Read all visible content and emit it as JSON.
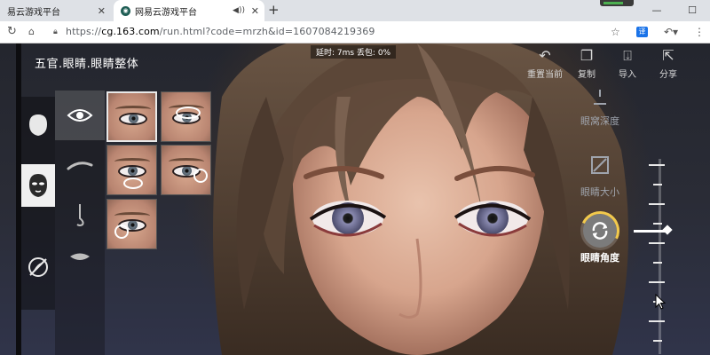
{
  "browser": {
    "tabs": [
      {
        "title": "易云游戏平台",
        "active": false
      },
      {
        "title": "网易云游戏平台",
        "active": true
      }
    ],
    "new_tab": "+",
    "window_controls": {
      "minimize": "—",
      "maximize": "☐",
      "close": "✕"
    },
    "url": {
      "scheme": "https://",
      "host": "cg.163.com",
      "path": "/run.html?code=mrzh&id=1607084219369"
    },
    "ext_badge": "译"
  },
  "game": {
    "latency_text": "延时: 7ms   丢包: 0%",
    "breadcrumb": "五官.眼睛.眼睛整体",
    "top_actions": [
      {
        "label": "重置当前",
        "icon": "reset-icon"
      },
      {
        "label": "复制",
        "icon": "copy-icon"
      },
      {
        "label": "导入",
        "icon": "import-icon"
      },
      {
        "label": "分享",
        "icon": "share-icon"
      }
    ],
    "params": [
      {
        "label": "眼窝深度",
        "icon": "eye-socket-icon",
        "active": false
      },
      {
        "label": "眼睛大小",
        "icon": "resize-icon",
        "active": false
      },
      {
        "label": "眼睛角度",
        "icon": "rotate-icon",
        "active": true
      }
    ],
    "categories": [
      {
        "icon": "head-shape-icon",
        "active": false
      },
      {
        "icon": "face-features-icon",
        "active": true
      },
      {
        "icon": "makeup-icon",
        "active": false
      }
    ],
    "sub_categories": [
      {
        "icon": "eye-icon",
        "active": true
      },
      {
        "icon": "eyebrow-icon",
        "active": false
      },
      {
        "icon": "nose-icon",
        "active": false
      },
      {
        "icon": "mouth-icon",
        "active": false
      }
    ],
    "presets": [
      {
        "selected": true,
        "marker": "none"
      },
      {
        "selected": false,
        "marker": "top-oval"
      },
      {
        "selected": false,
        "marker": "bottom-left-oval"
      },
      {
        "selected": false,
        "marker": "right-circle"
      },
      {
        "selected": false,
        "marker": "left-circle"
      }
    ],
    "angle_slider_level": 0.6
  }
}
